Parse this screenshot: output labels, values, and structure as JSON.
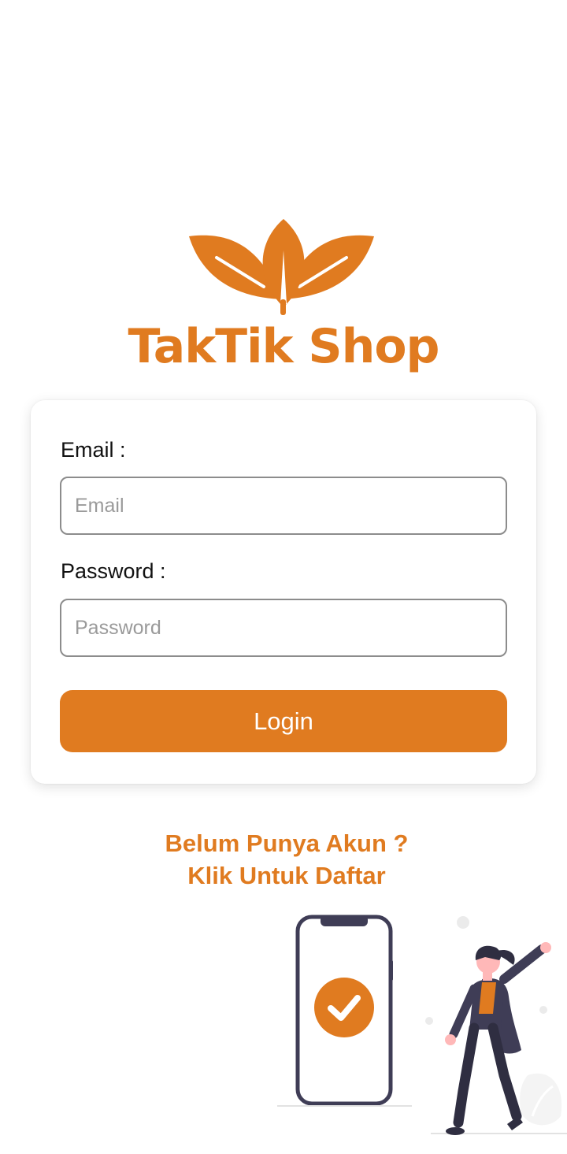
{
  "brand": {
    "name": "TakTik Shop",
    "color": "#E07B20"
  },
  "login_form": {
    "email_label": "Email :",
    "email_placeholder": "Email",
    "email_value": "",
    "password_label": "Password :",
    "password_placeholder": "Password",
    "password_value": "",
    "login_button_label": "Login"
  },
  "register": {
    "line1": "Belum Punya Akun ?",
    "line2": "Klik Untuk Daftar"
  },
  "illustration": {
    "icons": [
      "phone-icon",
      "checkmark-icon",
      "celebrating-person"
    ]
  }
}
